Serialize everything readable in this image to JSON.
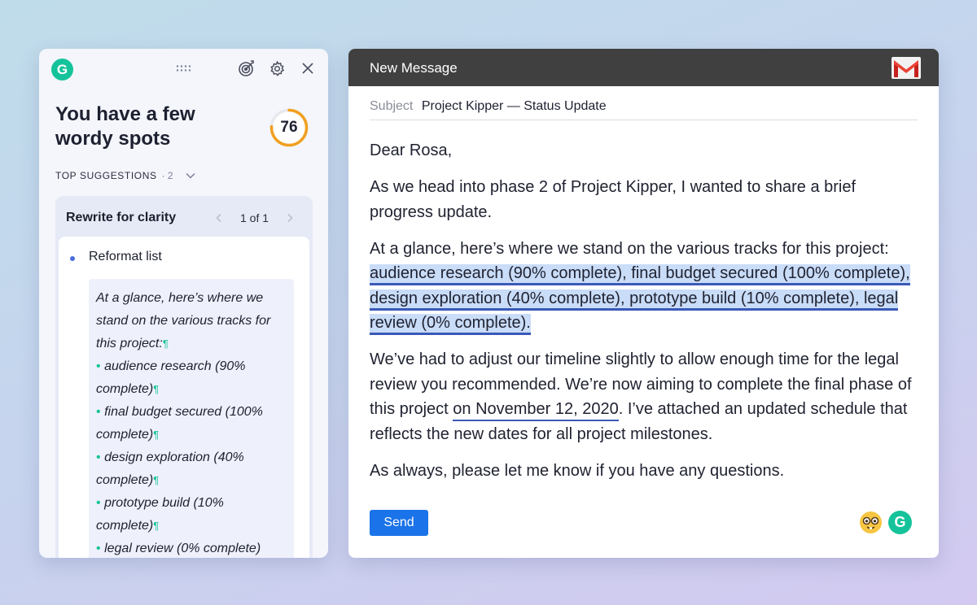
{
  "panel": {
    "logo_letter": "G",
    "headline": "You have a few wordy spots",
    "score": "76",
    "suggestions_title": "TOP SUGGESTIONS",
    "suggestions_count": "· 2",
    "card": {
      "title": "Rewrite for clarity",
      "pager": "1 of 1",
      "bullet": "Reformat list",
      "preview_intro": "At a glance, here’s where we stand on the various tracks for this project:",
      "pilcrow": "¶",
      "bullet_char": "•",
      "preview_items": [
        "audience research (90% complete)",
        "final budget secured (100% complete)",
        "design exploration (40% complete)",
        "prototype build (10% complete)",
        "legal review (0% complete)"
      ]
    },
    "icons": {
      "drag": "drag-handle-icon",
      "goals": "goals-target-icon",
      "settings": "gear-icon",
      "close": "close-icon"
    },
    "accent_color": "#15c39a",
    "score_ring_color": "#f0a020"
  },
  "compose": {
    "title": "New Message",
    "subject_label": "Subject",
    "subject_value": "Project Kipper — Status Update",
    "greeting": "Dear Rosa,",
    "para1": "As we head into phase 2 of Project Kipper, I wanted to share a brief progress update.",
    "para2_lead": "At a glance, here’s where we stand on the various tracks for this project: ",
    "para2_highlight": "audience research (90% complete), final budget secured (100% complete), design exploration (40% complete), prototype build (10% complete), legal review (0% complete).",
    "para3_a": "We’ve had to adjust our timeline slightly to allow enough time for the legal review you recommended. We’re now aiming to complete the final phase of this project ",
    "para3_underline": "on November 12, 2020",
    "para3_b": ". I’ve attached an updated schedule that reflects the new dates for all project milestones.",
    "para4": "As always, please let me know if you have any questions.",
    "send_label": "Send",
    "logo_letter": "G",
    "icons": {
      "gmail": "gmail-logo-icon",
      "nerd": "nerd-face-icon"
    },
    "send_color": "#1a73e8",
    "highlight_color": "#c9dcf8"
  }
}
